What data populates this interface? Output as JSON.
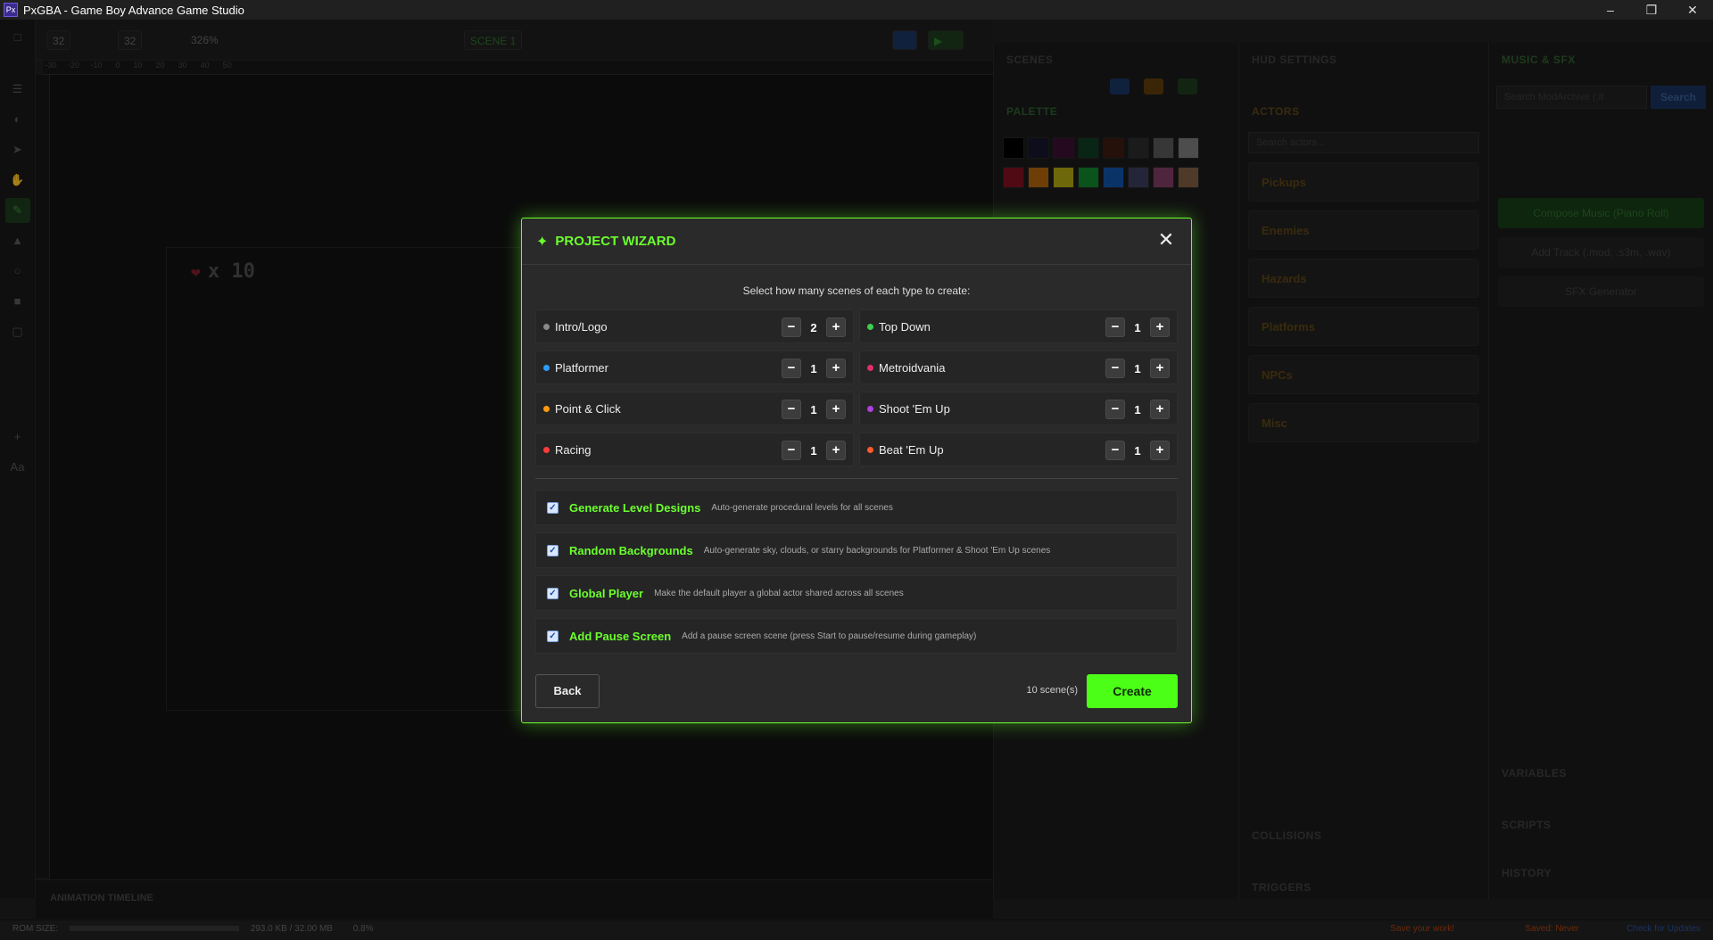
{
  "window": {
    "title": "PxGBA - Game Boy Advance Game Studio",
    "logo": "Px"
  },
  "toolbar": {
    "grid_w": "32",
    "grid_h": "32",
    "zoom": "326%",
    "scene_select": "SCENE 1"
  },
  "canvas": {
    "hud_text": "x 10"
  },
  "panels": {
    "scenes": "SCENES",
    "hud_settings": "HUD SETTINGS",
    "music_sfx": "MUSIC & SFX",
    "palette": "PALETTE",
    "actors": "ACTORS",
    "actors_search_placeholder": "Search actors...",
    "music_search_placeholder": "Search ModArchive (.it",
    "search_button": "Search",
    "compose": "Compose Music (Piano Roll)",
    "add_track": "Add Track (.mod, .s3m, .wav)",
    "sfx": "SFX Generator",
    "variables": "VARIABLES",
    "collisions": "COLLISIONS",
    "scripts": "SCRIPTS",
    "triggers": "TRIGGERS",
    "history": "HISTORY",
    "animation_timeline": "ANIMATION TIMELINE"
  },
  "actor_folders": [
    "Pickups",
    "Enemies",
    "Hazards",
    "Platforms",
    "NPCs",
    "Misc"
  ],
  "palette_colors": [
    "#000000",
    "#14142a",
    "#3a1030",
    "#0f3a22",
    "#3a1a10",
    "#2a2a2a",
    "#555555",
    "#777777",
    "#7a1020",
    "#a86008",
    "#a8a010",
    "#10802a",
    "#1050a0",
    "#3a3a5a",
    "#7a3a60",
    "#7a5a40"
  ],
  "status": {
    "rom_size_label": "ROM SIZE:",
    "rom_size": "293.0 KB / 32.00 MB",
    "rom_pct": "0.8%",
    "save_warning": "Save your work!",
    "saved": "Saved: Never",
    "updates": "Check for Updates"
  },
  "wizard": {
    "title": "PROJECT WIZARD",
    "subtitle": "Select how many scenes of each type to create:",
    "scene_types": [
      {
        "label": "Intro/Logo",
        "value": "2",
        "color": "#8a8a8a"
      },
      {
        "label": "Top Down",
        "value": "1",
        "color": "#3ccf4e"
      },
      {
        "label": "Platformer",
        "value": "1",
        "color": "#2e9bff"
      },
      {
        "label": "Metroidvania",
        "value": "1",
        "color": "#e0306a"
      },
      {
        "label": "Point & Click",
        "value": "1",
        "color": "#ff9a10"
      },
      {
        "label": "Shoot 'Em Up",
        "value": "1",
        "color": "#b040e0"
      },
      {
        "label": "Racing",
        "value": "1",
        "color": "#ff3a3a"
      },
      {
        "label": "Beat 'Em Up",
        "value": "1",
        "color": "#ff5a2a"
      }
    ],
    "options": [
      {
        "title": "Generate Level Designs",
        "desc": "Auto-generate procedural levels for all scenes",
        "checked": true
      },
      {
        "title": "Random Backgrounds",
        "desc": "Auto-generate sky, clouds, or starry backgrounds for Platformer & Shoot 'Em Up scenes",
        "checked": true
      },
      {
        "title": "Global Player",
        "desc": "Make the default player a global actor shared across all scenes",
        "checked": true
      },
      {
        "title": "Add Pause Screen",
        "desc": "Add a pause screen scene (press Start to pause/resume during gameplay)",
        "checked": true
      }
    ],
    "back_label": "Back",
    "count_label": "10 scene(s)",
    "create_label": "Create",
    "minus": "−",
    "plus": "+"
  }
}
